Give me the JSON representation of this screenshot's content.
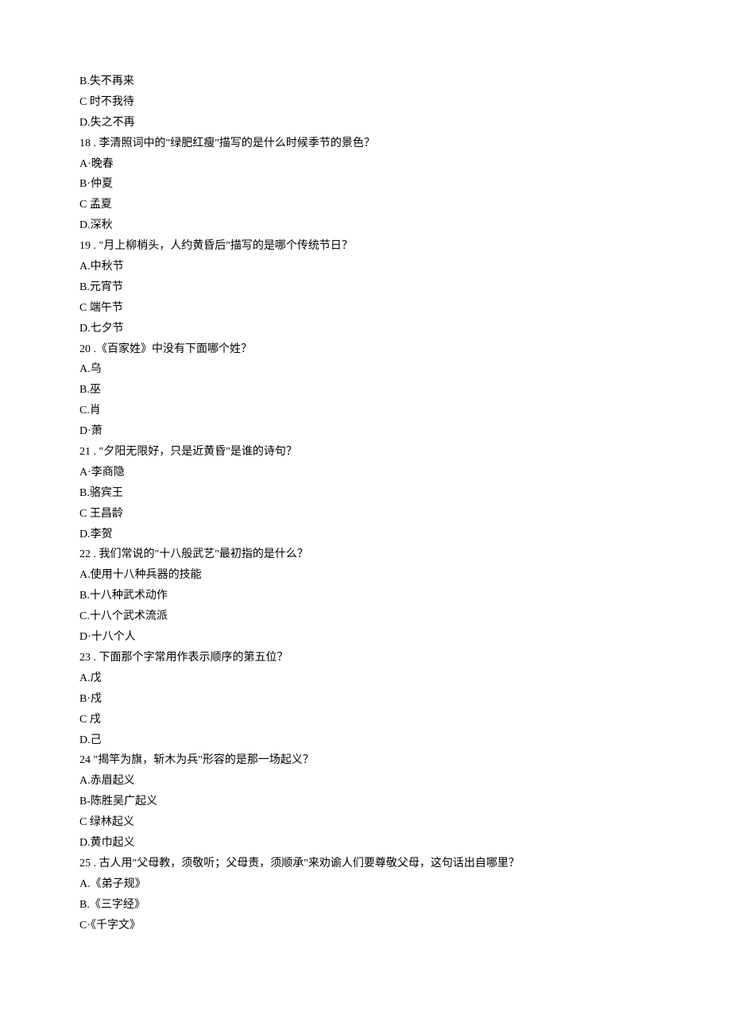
{
  "lines": [
    "B.失不再来",
    "C 时不我待",
    "D.失之不再",
    "18   . 李清照词中的\"绿肥红瘦\"描写的是什么时候季节的景色？",
    "A·晚春",
    "B·仲夏",
    "C 孟夏",
    "D.深秋",
    "19   . \"月上柳梢头，人约黄昏后\"描写的是哪个传统节日？",
    "A.中秋节",
    "B.元宵节",
    "C 端午节",
    "D.七夕节",
    "20   .《百家姓》中没有下面哪个姓？",
    "A.乌",
    "B.巫",
    "C.肖",
    "D·萧",
    "21   . \"夕阳无限好，只是近黄昏\"是谁的诗句？",
    "A·李商隐",
    "B.骆宾王",
    "C 王昌龄",
    "D.李贺",
    "22   . 我们常说的\"十八般武艺\"最初指的是什么？",
    "A.使用十八种兵器的技能",
    "B.十八种武术动作",
    "C.十八个武术流派",
    "D·十八个人",
    "23   . 下面那个字常用作表示顺序的第五位？",
    "A.戊",
    "B·戍",
    "C 戌",
    "D.己",
    "24     \"揭竿为旗，斩木为兵\"形容的是那一场起义？",
    "A.赤眉起义",
    "B-陈胜吴广起义",
    "C 绿林起义",
    "D.黄巾起义",
    "25   . 古人用\"父母教，须敬听；父母责，须顺承\"来劝谕人们要尊敬父母，这句话出自哪里？",
    "A.《弟子规》",
    "B.《三字经》",
    "C·《千字文》"
  ]
}
